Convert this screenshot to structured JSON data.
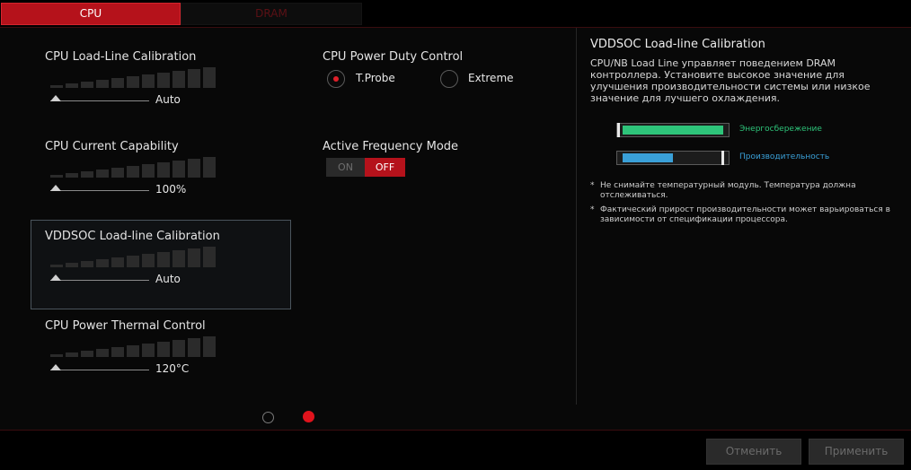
{
  "tabs": [
    {
      "label": "CPU",
      "active": true
    },
    {
      "label": "DRAM",
      "active": false
    }
  ],
  "left_settings": [
    {
      "label": "CPU Load-Line Calibration",
      "value": "Auto"
    },
    {
      "label": "CPU Current Capability",
      "value": "100%"
    },
    {
      "label": "VDDSOC Load-line Calibration",
      "value": "Auto",
      "selected": true
    },
    {
      "label": "CPU Power Thermal Control",
      "value": "120°C"
    }
  ],
  "power_duty": {
    "label": "CPU Power Duty Control",
    "options": [
      "T.Probe",
      "Extreme"
    ],
    "selected": "T.Probe"
  },
  "freq_mode": {
    "label": "Active Frequency Mode",
    "on_label": "ON",
    "off_label": "OFF",
    "value": "OFF"
  },
  "help": {
    "title": "VDDSOC Load-line Calibration",
    "description": "CPU/NB Load Line управляет поведением DRAM контроллера. Установите высокое значение для улучшения производительности системы или низкое значение для лучшего охлаждения.",
    "meters": [
      {
        "label": "Энергосбережение",
        "color": "#2ec47a",
        "level": 1.0
      },
      {
        "label": "Производительность",
        "color": "#3aa0d8",
        "level": 0.5
      }
    ],
    "notes": [
      "Не снимайте температурный модуль. Температура должна отслеживаться.",
      "Фактический прирост производительности может варьироваться в зависимости от спецификации процессора."
    ]
  },
  "pagination": {
    "pages": 2,
    "current": 2,
    "active_color": "#e0131c"
  },
  "buttons": {
    "cancel": "Отменить",
    "apply": "Применить"
  },
  "colors": {
    "accent": "#b5121b",
    "energy": "#2ec47a",
    "performance": "#3aa0d8"
  }
}
